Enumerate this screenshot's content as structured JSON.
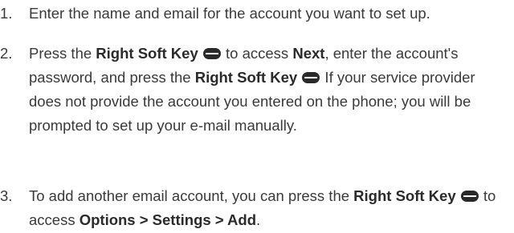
{
  "steps": [
    {
      "number": "1.",
      "t1": "Enter the name and email for the account you want to set up."
    },
    {
      "number": "2.",
      "t1": "Press the ",
      "b1": "Right Soft Key",
      "t2": " to access ",
      "b2": "Next",
      "t3": ", enter the account's password, and press the ",
      "b3": "Right Soft Key",
      "t4": " If your service provider does not provide the account you entered on the phone; you will be prompted to set up your e-mail manually."
    },
    {
      "number": "3.",
      "t1": "To add another email account, you can press the ",
      "b1": "Right Soft Key",
      "t2": " to access ",
      "b2": "Options > Settings > Add",
      "t3": "."
    }
  ],
  "icons": {
    "right_soft_key": "soft-key-icon"
  }
}
